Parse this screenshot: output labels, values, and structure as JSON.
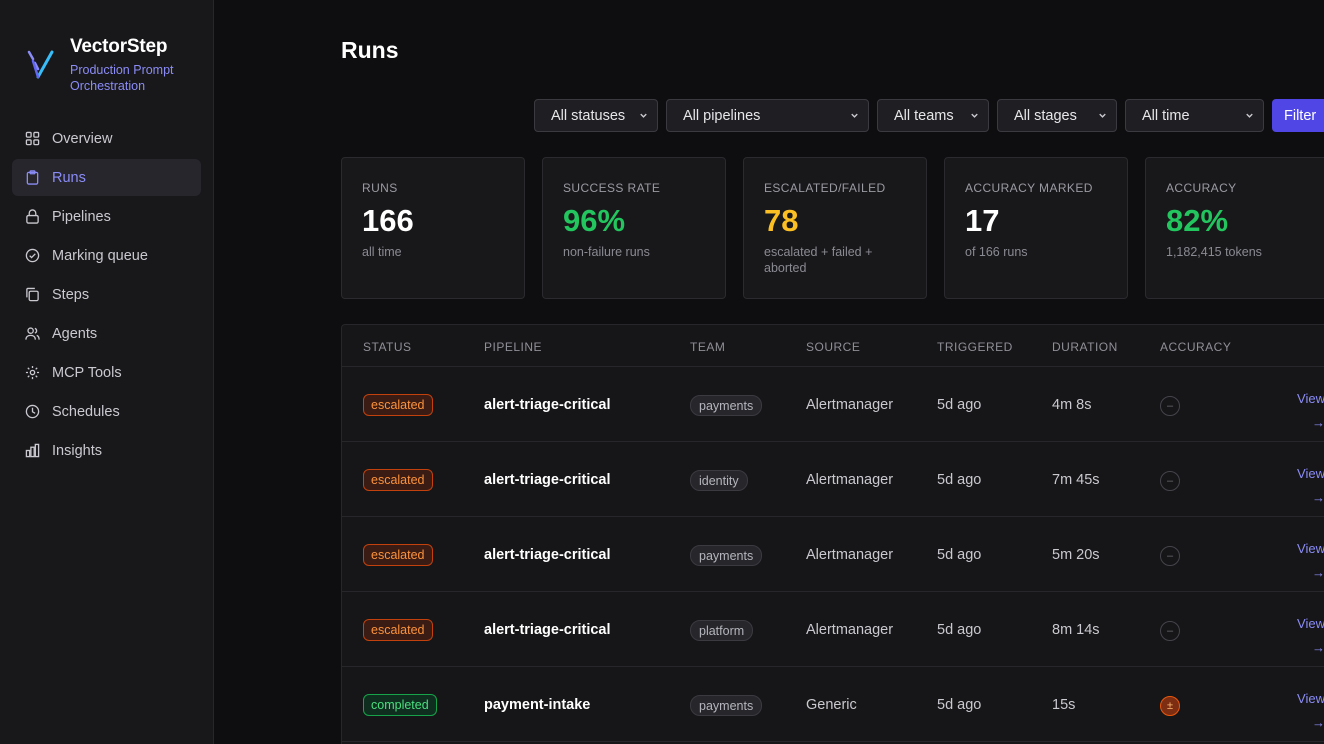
{
  "brand": {
    "name": "VectorStep",
    "subtitle": "Production Prompt Orchestration"
  },
  "nav": [
    {
      "label": "Overview",
      "icon": "grid-icon",
      "active": false
    },
    {
      "label": "Runs",
      "icon": "clipboard-icon",
      "active": true
    },
    {
      "label": "Pipelines",
      "icon": "lock-icon",
      "active": false
    },
    {
      "label": "Marking queue",
      "icon": "check-circle-icon",
      "active": false
    },
    {
      "label": "Steps",
      "icon": "copy-icon",
      "active": false
    },
    {
      "label": "Agents",
      "icon": "users-icon",
      "active": false
    },
    {
      "label": "MCP Tools",
      "icon": "gear-icon",
      "active": false
    },
    {
      "label": "Schedules",
      "icon": "clock-icon",
      "active": false
    },
    {
      "label": "Insights",
      "icon": "bar-chart-icon",
      "active": false
    }
  ],
  "page": {
    "title": "Runs"
  },
  "filters": {
    "status": "All statuses",
    "pipeline": "All pipelines",
    "team": "All teams",
    "stage": "All stages",
    "time": "All time",
    "button": "Filter"
  },
  "stats": [
    {
      "label": "RUNS",
      "value": "166",
      "sub": "all time",
      "color": "#ffffff"
    },
    {
      "label": "SUCCESS RATE",
      "value": "96%",
      "sub": "non-failure runs",
      "color": "#22c55e"
    },
    {
      "label": "ESCALATED/FAILED",
      "value": "78",
      "sub": "escalated + failed + aborted",
      "color": "#fbbf24"
    },
    {
      "label": "ACCURACY MARKED",
      "value": "17",
      "sub": "of 166 runs",
      "color": "#ffffff"
    },
    {
      "label": "ACCURACY",
      "value": "82%",
      "sub": "1,182,415 tokens",
      "color": "#22c55e"
    }
  ],
  "table": {
    "headers": [
      "STATUS",
      "PIPELINE",
      "TEAM",
      "SOURCE",
      "TRIGGERED",
      "DURATION",
      "ACCURACY"
    ],
    "rows": [
      {
        "status": "escalated",
        "pipeline": "alert-triage-critical",
        "team": "payments",
        "source": "Alertmanager",
        "triggered": "5d ago",
        "duration": "4m 8s",
        "accuracy": "–",
        "view": "View",
        "arrow": "→"
      },
      {
        "status": "escalated",
        "pipeline": "alert-triage-critical",
        "team": "identity",
        "source": "Alertmanager",
        "triggered": "5d ago",
        "duration": "7m 45s",
        "accuracy": "–",
        "view": "View",
        "arrow": "→"
      },
      {
        "status": "escalated",
        "pipeline": "alert-triage-critical",
        "team": "payments",
        "source": "Alertmanager",
        "triggered": "5d ago",
        "duration": "5m 20s",
        "accuracy": "–",
        "view": "View",
        "arrow": "→"
      },
      {
        "status": "escalated",
        "pipeline": "alert-triage-critical",
        "team": "platform",
        "source": "Alertmanager",
        "triggered": "5d ago",
        "duration": "8m 14s",
        "accuracy": "–",
        "view": "View",
        "arrow": "→"
      },
      {
        "status": "completed",
        "pipeline": "payment-intake",
        "team": "payments",
        "source": "Generic",
        "triggered": "5d ago",
        "duration": "15s",
        "accuracy": "±",
        "view": "View",
        "arrow": "→"
      }
    ]
  }
}
